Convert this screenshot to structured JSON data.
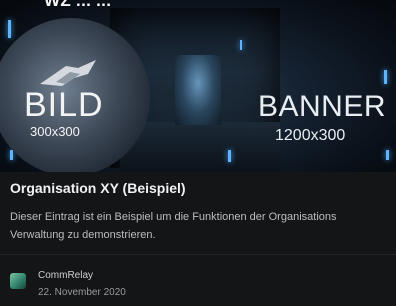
{
  "banner": {
    "top_title": "WZ ... ...",
    "image_label": "BILD",
    "image_size": "300x300",
    "banner_label": "BANNER",
    "banner_size": "1200x300"
  },
  "entry": {
    "title": "Organisation XY (Beispiel)",
    "description": "Dieser Eintrag ist ein Beispiel um die Funktionen der Organisations Verwaltung zu demonstrieren."
  },
  "author": {
    "name": "CommRelay",
    "date": "22. November 2020"
  }
}
